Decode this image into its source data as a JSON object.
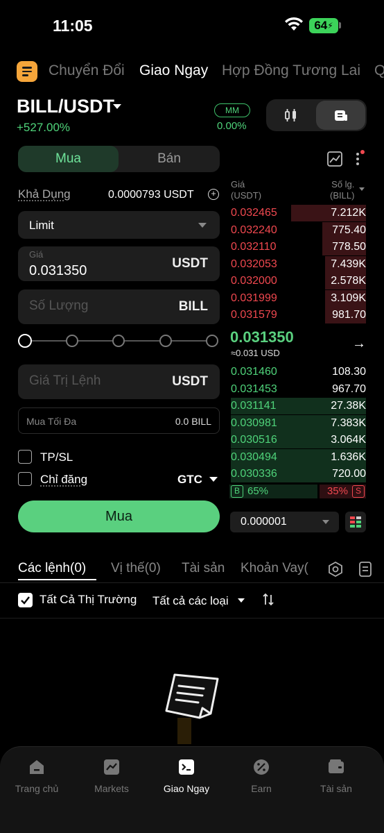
{
  "status": {
    "time": "11:05",
    "battery": "64"
  },
  "top_tabs": [
    "Chuyển Đổi",
    "Giao Ngay",
    "Hợp Đồng Tương Lai",
    "Q"
  ],
  "pair": {
    "name": "BILL/USDT",
    "change": "+527.00%",
    "mm_label": "MM",
    "mm_value": "0.00%"
  },
  "trade": {
    "buy_tab": "Mua",
    "sell_tab": "Bán",
    "available_label": "Khả Dụng",
    "available_value": "0.0000793 USDT",
    "order_type": "Limit",
    "price_label": "Giá",
    "price_value": "0.031350",
    "price_unit": "USDT",
    "qty_placeholder": "Số Lượng",
    "qty_unit": "BILL",
    "total_placeholder": "Giá Trị Lệnh",
    "total_unit": "USDT",
    "max_buy_label": "Mua Tối Đa",
    "max_buy_value": "0.0 BILL",
    "tpsl_label": "TP/SL",
    "post_only_label": "Chỉ đăng",
    "tif": "GTC",
    "submit": "Mua"
  },
  "orderbook": {
    "header_price": [
      "Giá",
      "(USDT)"
    ],
    "header_qty": [
      "Số lg.",
      "(BILL)"
    ],
    "asks": [
      {
        "price": "0.032465",
        "qty": "7.212K",
        "depth": 0.55
      },
      {
        "price": "0.032240",
        "qty": "775.40",
        "depth": 0.32
      },
      {
        "price": "0.032110",
        "qty": "778.50",
        "depth": 0.32
      },
      {
        "price": "0.032053",
        "qty": "7.439K",
        "depth": 0.3
      },
      {
        "price": "0.032000",
        "qty": "2.578K",
        "depth": 0.3
      },
      {
        "price": "0.031999",
        "qty": "3.109K",
        "depth": 0.3
      },
      {
        "price": "0.031579",
        "qty": "981.70",
        "depth": 0.3
      }
    ],
    "last_price": "0.031350",
    "last_usd": "≈0.031 USD",
    "bids": [
      {
        "price": "0.031460",
        "qty": "108.30",
        "depth": 0.0
      },
      {
        "price": "0.031453",
        "qty": "967.70",
        "depth": 0.0
      },
      {
        "price": "0.031141",
        "qty": "27.38K",
        "depth": 0.99
      },
      {
        "price": "0.030981",
        "qty": "7.383K",
        "depth": 0.99
      },
      {
        "price": "0.030516",
        "qty": "3.064K",
        "depth": 0.99
      },
      {
        "price": "0.030494",
        "qty": "1.636K",
        "depth": 0.99
      },
      {
        "price": "0.030336",
        "qty": "720.00",
        "depth": 0.99
      }
    ],
    "buy_tag": "B",
    "buy_pct": "65%",
    "sell_tag": "S",
    "sell_pct": "35%",
    "precision": "0.000001"
  },
  "orders_tabs": [
    "Các lệnh(0)",
    "Vị thế(0)",
    "Tài sản",
    "Khoản Vay("
  ],
  "filters": {
    "all_markets": "Tất Cả Thị Trường",
    "all_types": "Tất cả các loại"
  },
  "nav": [
    "Trang chủ",
    "Markets",
    "Giao Ngay",
    "Earn",
    "Tài sản"
  ],
  "colors": {
    "green": "#5ad07f",
    "red": "#f0484f",
    "accent": "#f5a53a"
  }
}
